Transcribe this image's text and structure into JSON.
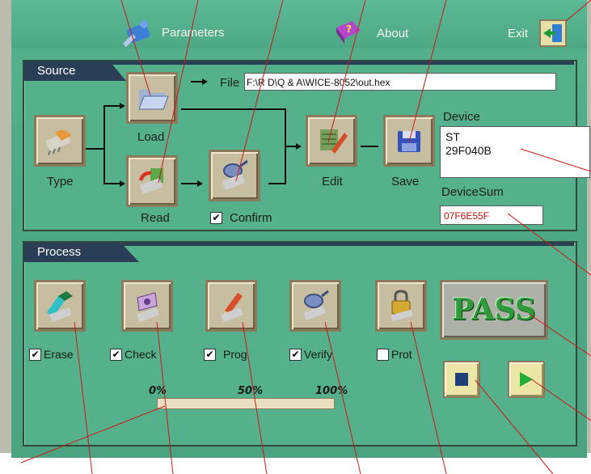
{
  "header": {
    "parameters_label": "Parameters",
    "about_label": "About",
    "exit_label": "Exit"
  },
  "source": {
    "section_title": "Source",
    "file_label": "File",
    "file_value": "F:\\R D\\Q & A\\WICE-8052\\out.hex",
    "type_label": "Type",
    "load_label": "Load",
    "read_label": "Read",
    "confirm_label": "Confirm",
    "confirm_checked": true,
    "edit_label": "Edit",
    "save_label": "Save",
    "device_label": "Device",
    "device_line1": "ST",
    "device_line2": "29F040B",
    "devicesum_label": "DeviceSum",
    "devicesum_value": "07F6E55F"
  },
  "process": {
    "section_title": "Process",
    "steps": [
      {
        "label": "Erase",
        "checked": true
      },
      {
        "label": "Check",
        "checked": true
      },
      {
        "label": "Prog",
        "checked": true
      },
      {
        "label": "Verify",
        "checked": true
      },
      {
        "label": "Prot",
        "checked": false
      }
    ],
    "progress_ticks": [
      "0%",
      "50%",
      "100%"
    ],
    "progress_fraction": 0,
    "result_text": "PASS"
  },
  "colors": {
    "app_green": "#4fa886",
    "section_navy": "#2a3e55",
    "button_tan": "#c7bda0",
    "pass_green": "#2f9a3a",
    "devicesum_red": "#c01010",
    "leader_red": "#d01818"
  }
}
